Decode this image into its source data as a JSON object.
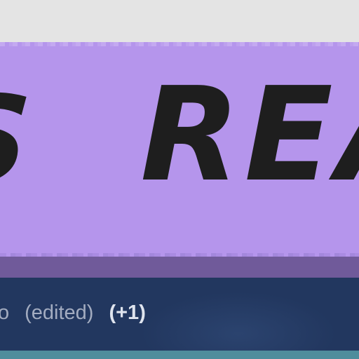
{
  "banner": {
    "fragment_left": "S",
    "fragment_right": "REA",
    "background_color": "#b595ec",
    "text_color": "#1e1e1e"
  },
  "meta": {
    "author_tail": "o",
    "edited_label": "(edited)",
    "revision_count": "(+1)"
  },
  "colors": {
    "meta_bar": "#22375f",
    "shadow_band": "#705a9a",
    "top_strip": "#e4e4e4",
    "bottom_strip": "#4f8d9c"
  }
}
